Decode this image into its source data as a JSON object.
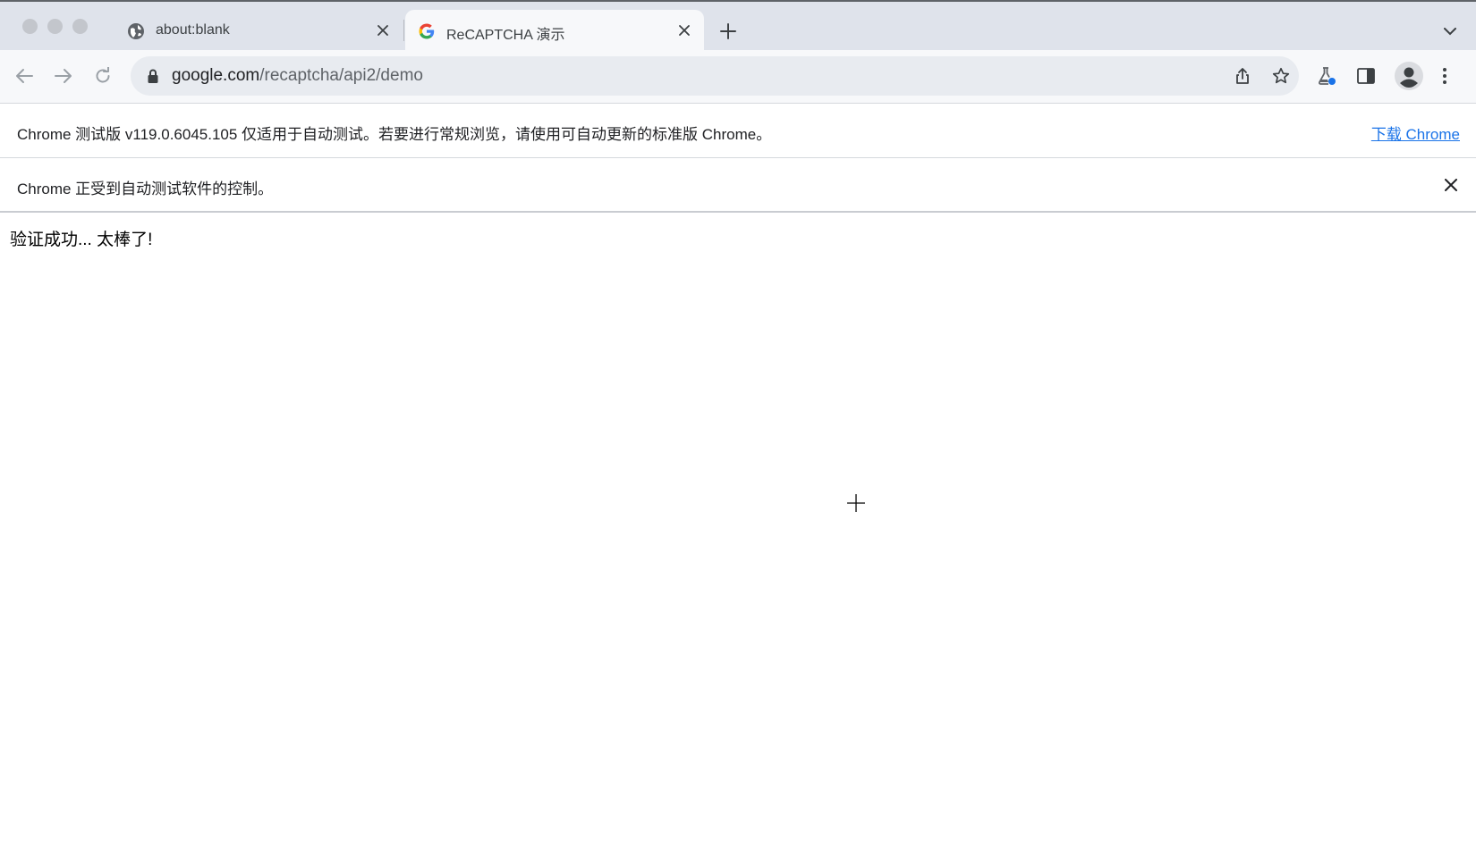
{
  "tabs": [
    {
      "title": "about:blank",
      "active": false,
      "icon": "globe-icon"
    },
    {
      "title": "ReCAPTCHA 演示",
      "active": true,
      "icon": "google-g-icon"
    }
  ],
  "toolbar": {
    "url_host": "google.com",
    "url_path": "/recaptcha/api2/demo"
  },
  "infobars": {
    "beta_message": "Chrome 测试版 v119.0.6045.105 仅适用于自动测试。若要进行常规浏览，请使用可自动更新的标准版 Chrome。",
    "download_link": "下载 Chrome",
    "automation_message": "Chrome 正受到自动测试软件的控制。"
  },
  "page": {
    "success_text": "验证成功... 太棒了!"
  },
  "colors": {
    "tabstrip_bg": "#dfe3eb",
    "toolbar_bg": "#f7f8fa",
    "omnibox_bg": "#e8ebf0",
    "link": "#1a73e8",
    "google_blue": "#4285f4",
    "google_red": "#ea4335",
    "google_yellow": "#fbbc05",
    "google_green": "#34a853"
  }
}
